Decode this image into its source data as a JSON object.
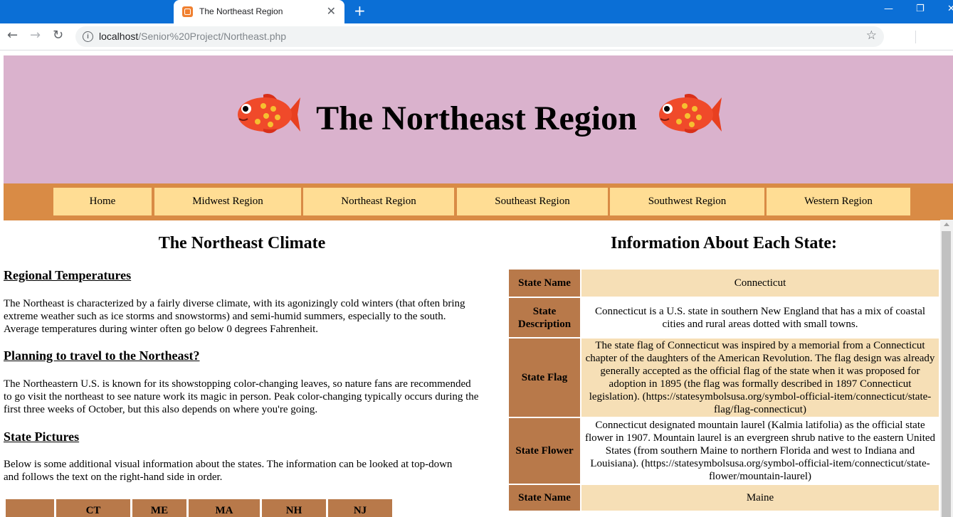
{
  "browser": {
    "tab_title": "The Northeast Region",
    "url_host": "localhost",
    "url_path": "/Senior%20Project/Northeast.php"
  },
  "page": {
    "title": "The Northeast Region",
    "nav": [
      "Home",
      "Midwest Region",
      "Northeast Region",
      "Southeast Region",
      "Southwest Region",
      "Western Region"
    ],
    "left": {
      "heading": "The Northeast Climate",
      "sections": [
        {
          "heading": "Regional Temperatures",
          "text": "The Northeast is characterized by a fairly diverse climate, with its agonizingly cold winters (that often bring extreme weather such as ice storms and snowstorms) and semi-humid summers, especially to the south. Average temperatures during winter often go below 0 degrees Fahrenheit."
        },
        {
          "heading": "Planning to travel to the Northeast?",
          "text": "The Northeastern U.S. is known for its showstopping color-changing leaves, so nature fans are recommended to go visit the northeast to see nature work its magic in person. Peak color-changing typically occurs during the first three weeks of October, but this also depends on where you're going."
        },
        {
          "heading": "State Pictures",
          "text": "Below is some additional visual information about the states. The information can be looked at top-down and follows the text on the right-hand side in order."
        }
      ],
      "picture_columns": [
        "",
        "CT",
        "ME",
        "MA",
        "NH",
        "NJ"
      ]
    },
    "right": {
      "heading": "Information About Each State:",
      "rows": [
        {
          "label": "State Name",
          "value": "Connecticut"
        },
        {
          "label": "State Description",
          "value": "Connecticut is a U.S. state in southern New England that has a mix of coastal cities and rural areas dotted with small towns."
        },
        {
          "label": "State Flag",
          "value": "The state flag of Connecticut was inspired by a memorial from a Connecticut chapter of the daughters of the American Revolution. The flag design was already generally accepted as the official flag of the state when it was proposed for adoption in 1895 (the flag was formally described in 1897 Connecticut legislation). (https://statesymbolsusa.org/symbol-official-item/connecticut/state-flag/flag-connecticut)"
        },
        {
          "label": "State Flower",
          "value": "Connecticut designated mountain laurel (Kalmia latifolia) as the official state flower in 1907. Mountain laurel is an evergreen shrub native to the eastern United States (from southern Maine to northern Florida and west to Indiana and Louisiana). (https://statesymbolsusa.org/symbol-official-item/connecticut/state-flower/mountain-laurel)"
        },
        {
          "label": "State Name",
          "value": "Maine"
        }
      ]
    }
  }
}
